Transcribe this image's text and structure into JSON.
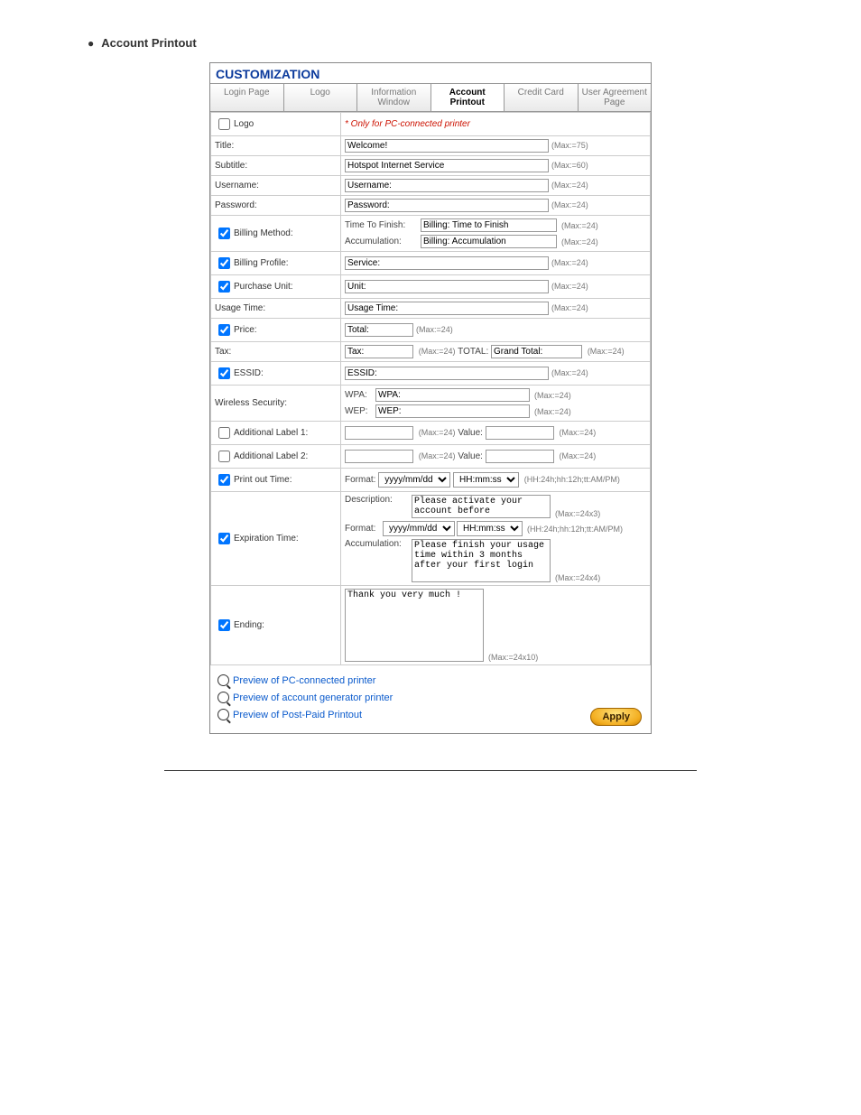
{
  "section_title": "Account Printout",
  "panel_title": "CUSTOMIZATION",
  "tabs": {
    "login": "Login Page",
    "logo": "Logo",
    "info": "Information Window",
    "account": "Account Printout",
    "credit": "Credit Card",
    "agreement": "User Agreement Page"
  },
  "rows": {
    "logo": "Logo",
    "title": "Title:",
    "subtitle": "Subtitle:",
    "username": "Username:",
    "password": "Password:",
    "billing_method": "Billing Method:",
    "billing_profile": "Billing Profile:",
    "purchase_unit": "Purchase Unit:",
    "usage_time": "Usage Time:",
    "price": "Price:",
    "tax": "Tax:",
    "essid": "ESSID:",
    "wireless_security": "Wireless Security:",
    "addl1": "Additional Label 1:",
    "addl2": "Additional Label 2:",
    "printout_time": "Print out Time:",
    "expiration_time": "Expiration Time:",
    "ending": "Ending:"
  },
  "vals": {
    "only_pc": "* Only for PC-connected printer",
    "title": "Welcome!",
    "subtitle": "Hotspot Internet Service",
    "username": "Username:",
    "password": "Password:",
    "ttf_label": "Time To Finish:",
    "ttf_val": "Billing: Time to Finish",
    "acc_label": "Accumulation:",
    "acc_val": "Billing: Accumulation",
    "service": "Service:",
    "unit": "Unit:",
    "usage_time": "Usage Time:",
    "total": "Total:",
    "tax_field": "Tax:",
    "total_label": "TOTAL:",
    "grand_total": "Grand Total:",
    "essid": "ESSID:",
    "wpa_lbl": "WPA:",
    "wpa_val": "WPA:",
    "wep_lbl": "WEP:",
    "wep_val": "WEP:",
    "value_lbl": "Value:",
    "format_lbl": "Format:",
    "dateopt": "yyyy/mm/dd",
    "timeopt": "HH:mm:ss",
    "hh_hint": "(HH:24h;hh:12h;tt:AM/PM)",
    "desc_lbl": "Description:",
    "desc_text": "Please activate your account before",
    "acc2_lbl": "Accumulation:",
    "acc2_text": "Please finish your usage time within 3 months after your first login",
    "ending_text": "Thank you very much !"
  },
  "hints": {
    "max75": "(Max:=75)",
    "max60": "(Max:=60)",
    "max24": "(Max:=24)",
    "max24x3": "(Max:=24x3)",
    "max24x4": "(Max:=24x4)",
    "max24x10": "(Max:=24x10)"
  },
  "links": {
    "pc": "Preview of PC-connected printer",
    "gen": "Preview of account generator printer",
    "post": "Preview of Post-Paid Printout"
  },
  "apply": "Apply"
}
